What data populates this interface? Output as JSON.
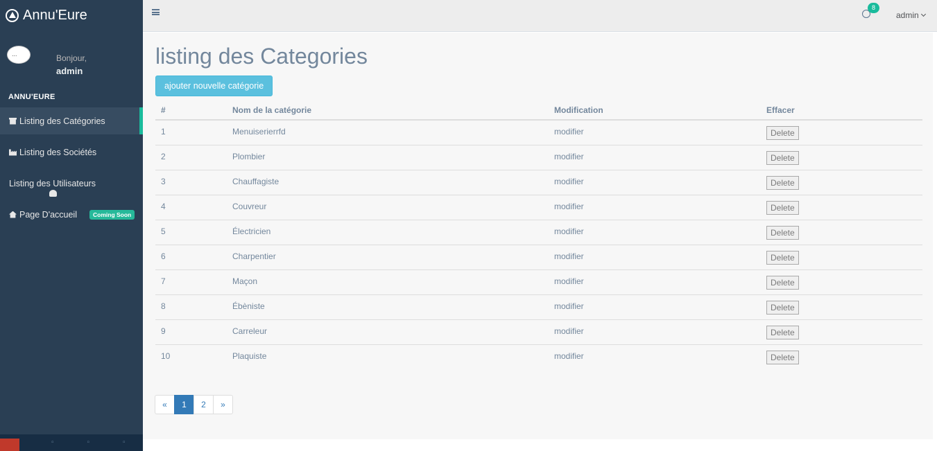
{
  "brand": {
    "name": "Annu'Eure",
    "icon": "app-store-icon"
  },
  "profile": {
    "avatar_alt": "...",
    "greeting": "Bonjour,",
    "username": "admin"
  },
  "sidebar": {
    "section_title": "ANNU'EURE",
    "items": [
      {
        "label": "Listing des Catégories",
        "icon": "archive-icon",
        "active": true
      },
      {
        "label": "Listing des Sociétés",
        "icon": "industry-icon",
        "active": false
      },
      {
        "label": "Listing des Utilisateurs",
        "icon": "user-icon",
        "active": false
      },
      {
        "label": "Page D'accueil",
        "icon": "home-icon",
        "active": false,
        "badge": "Coming Soon"
      }
    ],
    "footer_icons": [
      "settings-icon",
      "fullscreen-icon",
      "lock-icon",
      "logout-icon"
    ]
  },
  "topnav": {
    "menu_icon": "bars-icon",
    "notification_count": "8",
    "user_label": "admin"
  },
  "main": {
    "title": "listing des Categories",
    "add_button": "ajouter nouvelle catégorie",
    "table": {
      "headers": [
        "#",
        "Nom de la catégorie",
        "Modification",
        "Effacer"
      ],
      "rows": [
        {
          "id": "1",
          "name": "Menuiserierrfd",
          "modify": "modifier",
          "delete": "Delete"
        },
        {
          "id": "2",
          "name": "Plombier",
          "modify": "modifier",
          "delete": "Delete"
        },
        {
          "id": "3",
          "name": "Chauffagiste",
          "modify": "modifier",
          "delete": "Delete"
        },
        {
          "id": "4",
          "name": "Couvreur",
          "modify": "modifier",
          "delete": "Delete"
        },
        {
          "id": "5",
          "name": "Électricien",
          "modify": "modifier",
          "delete": "Delete"
        },
        {
          "id": "6",
          "name": "Charpentier",
          "modify": "modifier",
          "delete": "Delete"
        },
        {
          "id": "7",
          "name": "Maçon",
          "modify": "modifier",
          "delete": "Delete"
        },
        {
          "id": "8",
          "name": "Ébèniste",
          "modify": "modifier",
          "delete": "Delete"
        },
        {
          "id": "9",
          "name": "Carreleur",
          "modify": "modifier",
          "delete": "Delete"
        },
        {
          "id": "10",
          "name": "Plaquiste",
          "modify": "modifier",
          "delete": "Delete"
        }
      ]
    },
    "pagination": {
      "prev": "«",
      "pages": [
        "1",
        "2"
      ],
      "current": "1",
      "next": "»"
    }
  },
  "colors": {
    "sidebar": "#2a3f54",
    "accent": "#1abb9c",
    "info_button": "#5bc0de",
    "page_active": "#337ab7",
    "text": "#73879c"
  }
}
